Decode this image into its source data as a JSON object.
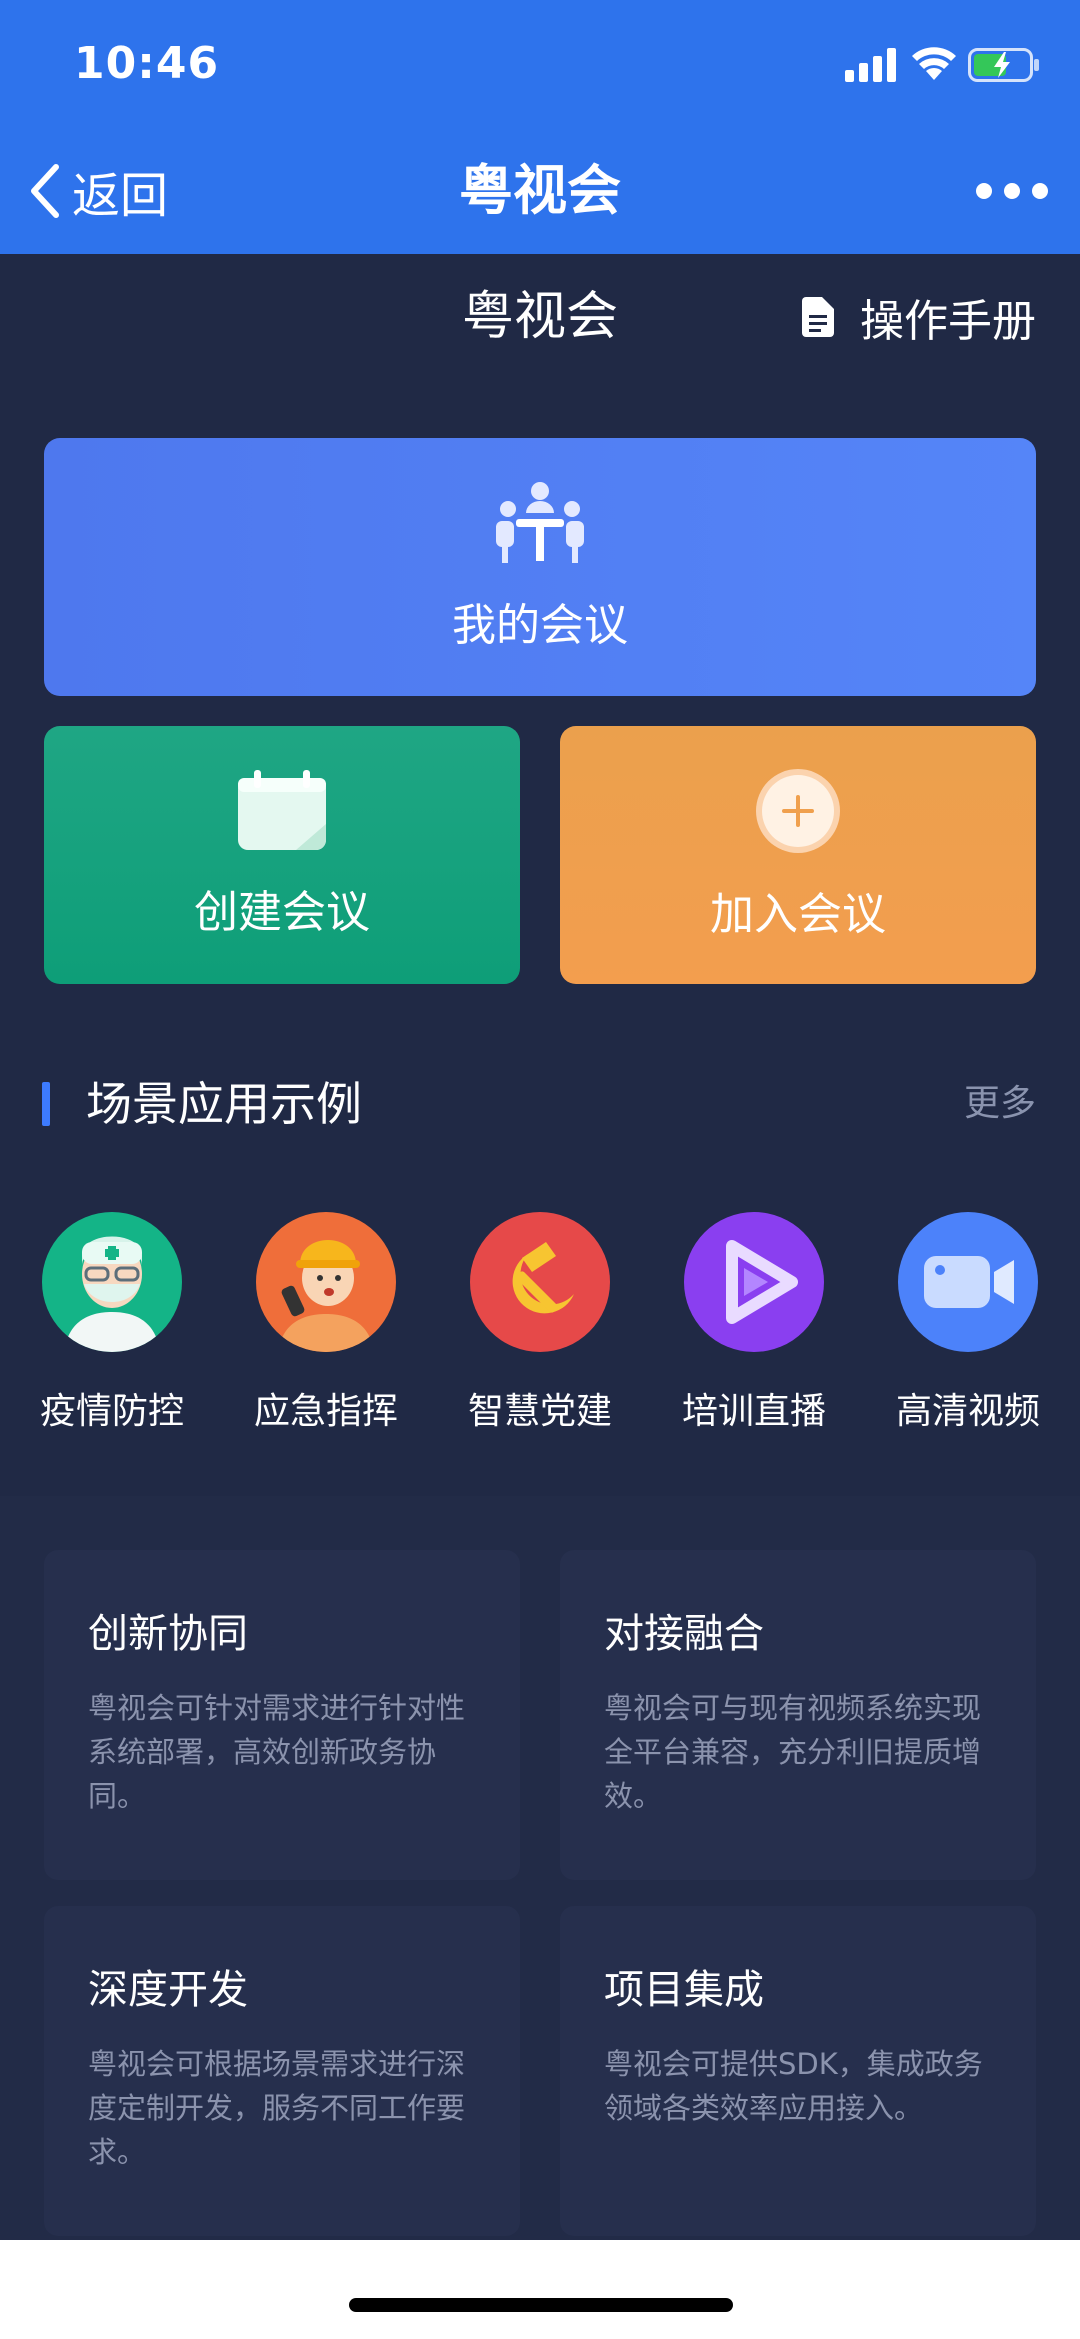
{
  "status_bar": {
    "time": "10:46"
  },
  "nav": {
    "back_label": "返回",
    "title": "粤视会"
  },
  "page": {
    "title": "粤视会",
    "manual_label": "操作手册"
  },
  "actions": {
    "my_meetings": "我的会议",
    "create_meeting": "创建会议",
    "join_meeting": "加入会议"
  },
  "section": {
    "title": "场景应用示例",
    "more": "更多"
  },
  "scenes": [
    {
      "label": "疫情防控",
      "icon": "doctor-icon"
    },
    {
      "label": "应急指挥",
      "icon": "worker-icon"
    },
    {
      "label": "智慧党建",
      "icon": "party-emblem-icon"
    },
    {
      "label": "培训直播",
      "icon": "play-icon"
    },
    {
      "label": "高清视频",
      "icon": "video-camera-icon"
    }
  ],
  "features": [
    {
      "title": "创新协同",
      "desc": "粤视会可针对需求进行针对性系统部署，高效创新政务协同。"
    },
    {
      "title": "对接融合",
      "desc": "粤视会可与现有视频系统实现全平台兼容，充分利旧提质增效。"
    },
    {
      "title": "深度开发",
      "desc": "粤视会可根据场景需求进行深度定制开发，服务不同工作要求。"
    },
    {
      "title": "项目集成",
      "desc": "粤视会可提供SDK，集成政务领域各类效率应用接入。"
    }
  ],
  "colors": {
    "header_blue": "#2E73EC",
    "page_bg": "#202945",
    "my_meeting_card": "#5380F5",
    "create_card": "#14A27D",
    "join_card": "#F0A04D",
    "section_accent": "#3D7BFF"
  }
}
